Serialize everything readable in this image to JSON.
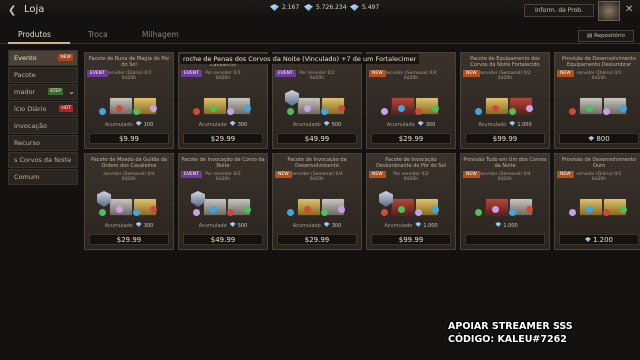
{
  "topbar": {
    "back_icon": "chevron-left",
    "title": "Loja",
    "currencies": [
      {
        "icon": "gem-icon",
        "value": "2.167"
      },
      {
        "icon": "gem-icon",
        "value": "5.726.234"
      },
      {
        "icon": "gem-icon",
        "value": "5.497"
      }
    ],
    "info_button": "Inform. de Prob.",
    "close_icon": "close"
  },
  "tabs": [
    {
      "label": "Produtos",
      "active": true
    },
    {
      "label": "Troca",
      "active": false
    },
    {
      "label": "Milhagem",
      "active": false
    }
  ],
  "repo_button": "Repositório",
  "sidebar": [
    {
      "label": "Evento",
      "badge": "NEW",
      "active": true
    },
    {
      "label": "Pacote",
      "badge": "",
      "active": false
    },
    {
      "label": "mador",
      "badge": "STEP",
      "active": false
    },
    {
      "label": "ício Diário",
      "badge": "HOT",
      "active": false
    },
    {
      "label": "Invocação",
      "badge": "",
      "active": false
    },
    {
      "label": "Recurso",
      "badge": "",
      "active": false
    },
    {
      "label": "s Corvos da Noite",
      "badge": "",
      "active": false
    },
    {
      "label": "Comum",
      "badge": "",
      "active": false
    }
  ],
  "overlay_text": "roche de Penas dos Corvos da Noite (Vinculado) +7 de um Fortalecimer",
  "cards": [
    {
      "title": "Pacote de Runa de Magia do Pôr do Sol",
      "badge": "EVENT",
      "limit": "servidor (Diário) 0/1",
      "timer": "6d20h",
      "acc": "Acumulado",
      "acc_value": "100",
      "price": "$9.99"
    },
    {
      "title": "Pacote de ... da Ordem dos Cavaleiros",
      "badge": "EVENT",
      "limit": "Por servidor 0/1",
      "timer": "6d20h",
      "acc": "Acumulado",
      "acc_value": "300",
      "price": "$29.99"
    },
    {
      "title": "",
      "badge": "EVENT",
      "limit": "Por servidor 0/2",
      "timer": "6d20h",
      "acc": "Acumulado",
      "acc_value": "500",
      "price": "$49.99"
    },
    {
      "title": "",
      "badge": "NEW",
      "limit": "servidor (Semanal) 0/4",
      "timer": "6d20h",
      "acc": "Acumulado",
      "acc_value": "300",
      "price": "$29.99"
    },
    {
      "title": "Pacote de Equipamento dos Corvos da Noite Fortalecido",
      "badge": "NEW",
      "limit": "servidor (Semanal) 0/2",
      "timer": "6d20h",
      "acc": "Acumulado",
      "acc_value": "1.000",
      "price": "$99.99"
    },
    {
      "title": "Provisão de Desenvolvimento Equipamento Deslumbrar",
      "badge": "NEW",
      "limit": "servidor (Diário) 0/1",
      "timer": "6d20h",
      "acc": "",
      "acc_value": "",
      "price": "800"
    },
    {
      "title": "Pacote de Moeda da Guilda da Ordem dos Cavaleiros",
      "badge": "",
      "limit": "servidor (Semanal) 0/4",
      "timer": "6d20h",
      "acc": "Acumulado",
      "acc_value": "300",
      "price": "$29.99"
    },
    {
      "title": "Pacote de Invocação de Corvo da Noite",
      "badge": "EVENT",
      "limit": "Por servidor 0/2",
      "timer": "6d20h",
      "acc": "Acumulado",
      "acc_value": "500",
      "price": "$49.99"
    },
    {
      "title": "Pacote de Invocação de Desenvolvimento",
      "badge": "NEW",
      "limit": "servidor (Semanal) 0/4",
      "timer": "6d20h",
      "acc": "Acumulado",
      "acc_value": "300",
      "price": "$29.99"
    },
    {
      "title": "Pacote de Invocação Deslumbrante do Pôr do Sol",
      "badge": "NEW",
      "limit": "Por servidor 0/2",
      "timer": "6d20h",
      "acc": "Acumulado",
      "acc_value": "1.000",
      "price": "$99.99"
    },
    {
      "title": "Provisão Tudo em Um dos Corvos da Noite",
      "badge": "NEW",
      "limit": "servidor (Semanal) 0/4",
      "timer": "6d20h",
      "acc": "",
      "acc_value": "1.000",
      "price": ""
    },
    {
      "title": "Provisão de Desenvolvimento Ouro",
      "badge": "NEW",
      "limit": "servidor (Diário) 0/1",
      "timer": "6d20h",
      "acc": "",
      "acc_value": "",
      "price": "1.200"
    }
  ],
  "streamer": {
    "line1": "APOIAR STREAMER SSS",
    "line2": "CÓDIGO: KALEU#7262"
  }
}
